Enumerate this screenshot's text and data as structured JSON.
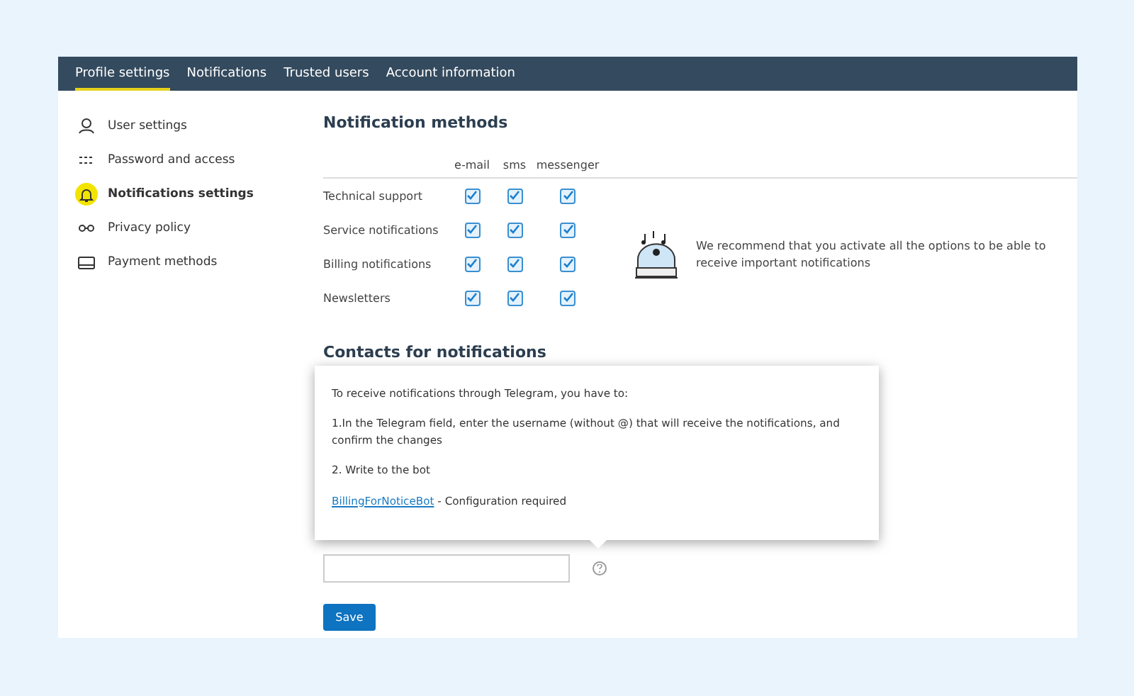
{
  "nav": {
    "tabs": [
      {
        "label": "Profile settings",
        "selected": true
      },
      {
        "label": "Notifications",
        "selected": false
      },
      {
        "label": "Trusted users",
        "selected": false
      },
      {
        "label": "Account information",
        "selected": false
      }
    ]
  },
  "sidebar": {
    "items": [
      {
        "kind": "user",
        "label": "User settings",
        "selected": false
      },
      {
        "kind": "password",
        "label": "Password and access",
        "selected": false
      },
      {
        "kind": "bell",
        "label": "Notifications settings",
        "selected": true
      },
      {
        "kind": "glasses",
        "label": "Privacy policy",
        "selected": false
      },
      {
        "kind": "card",
        "label": "Payment methods",
        "selected": false
      }
    ]
  },
  "methods": {
    "title": "Notification methods",
    "columns": [
      "e-mail",
      "sms",
      "messenger"
    ],
    "rows": [
      {
        "label": "Technical support",
        "checked": [
          true,
          true,
          true
        ]
      },
      {
        "label": "Service notifications",
        "checked": [
          true,
          true,
          true
        ]
      },
      {
        "label": "Billing notifications",
        "checked": [
          true,
          true,
          true
        ]
      },
      {
        "label": "Newsletters",
        "checked": [
          true,
          true,
          true
        ]
      }
    ],
    "recommendation": "We recommend that you activate all the options to be able to receive important notifications"
  },
  "contacts": {
    "title": "Contacts for notifications",
    "tooltip": {
      "intro": "To receive notifications through Telegram, you have to:",
      "step_1": "1.In the Telegram field, enter the username (without @) that will receive the notifications, and confirm the changes",
      "step_2": "2. Write to the bot",
      "link": "BillingForNoticeBot",
      "link_note": " - Configuration required"
    },
    "save": "Save"
  }
}
